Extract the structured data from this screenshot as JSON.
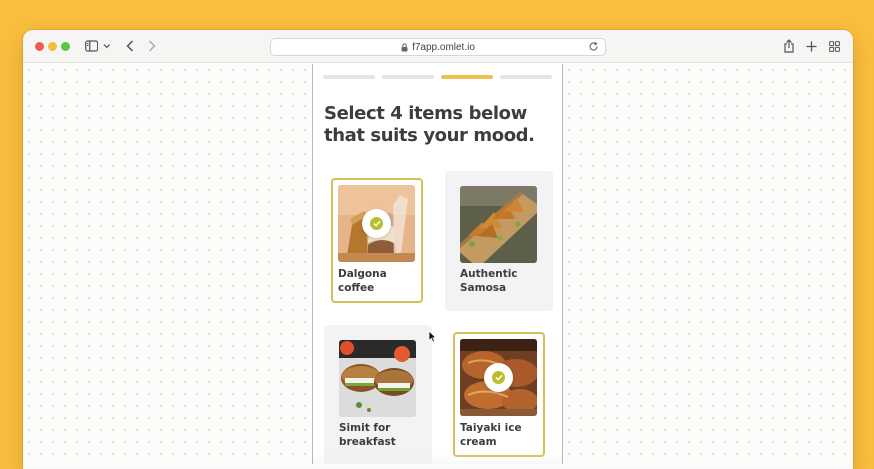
{
  "browser": {
    "url": "f7app.omlet.io",
    "icons": [
      "sidebar-icon",
      "chevron-down-icon",
      "back-icon",
      "forward-icon",
      "lock-icon",
      "reload-icon",
      "share-icon",
      "plus-icon",
      "tab-grid-icon"
    ]
  },
  "progress": {
    "steps": 4,
    "active_step": 3,
    "active_color": "#ebc14f",
    "inactive_color": "#e4e4e4"
  },
  "headline": "Select 4 items below that suits your mood.",
  "items": [
    {
      "label": "Dalgona coffee",
      "selected": true
    },
    {
      "label": "Authentic Samosa",
      "selected": false
    },
    {
      "label": "Simit for breakfast",
      "selected": false
    },
    {
      "label": "Taiyaki ice cream",
      "selected": true
    }
  ],
  "colors": {
    "background": "#fbbf3f",
    "selected_border": "#d7bd55",
    "check": "#b9bf2c",
    "text": "#3d3d3f"
  }
}
